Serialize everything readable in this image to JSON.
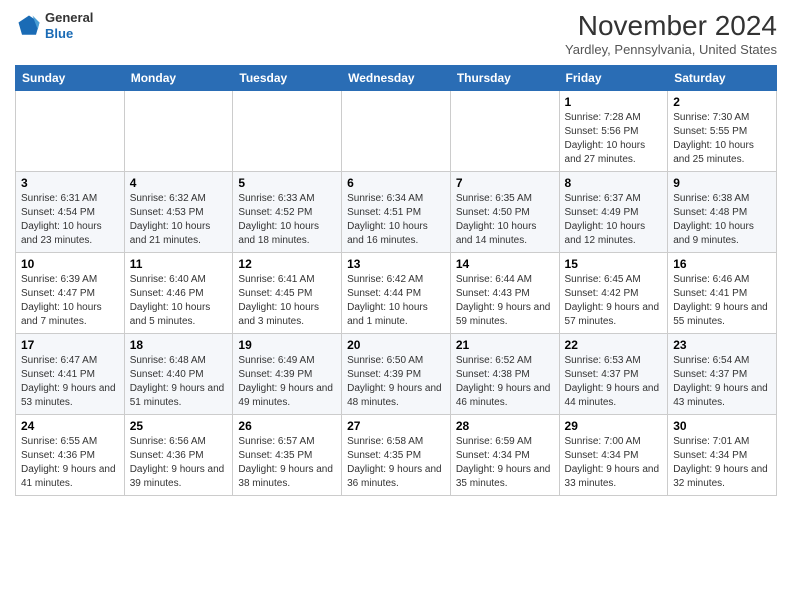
{
  "header": {
    "logo": {
      "line1": "General",
      "line2": "Blue"
    },
    "title": "November 2024",
    "location": "Yardley, Pennsylvania, United States"
  },
  "days_of_week": [
    "Sunday",
    "Monday",
    "Tuesday",
    "Wednesday",
    "Thursday",
    "Friday",
    "Saturday"
  ],
  "weeks": [
    [
      {
        "day": "",
        "info": ""
      },
      {
        "day": "",
        "info": ""
      },
      {
        "day": "",
        "info": ""
      },
      {
        "day": "",
        "info": ""
      },
      {
        "day": "",
        "info": ""
      },
      {
        "day": "1",
        "info": "Sunrise: 7:28 AM\nSunset: 5:56 PM\nDaylight: 10 hours and 27 minutes."
      },
      {
        "day": "2",
        "info": "Sunrise: 7:30 AM\nSunset: 5:55 PM\nDaylight: 10 hours and 25 minutes."
      }
    ],
    [
      {
        "day": "3",
        "info": "Sunrise: 6:31 AM\nSunset: 4:54 PM\nDaylight: 10 hours and 23 minutes."
      },
      {
        "day": "4",
        "info": "Sunrise: 6:32 AM\nSunset: 4:53 PM\nDaylight: 10 hours and 21 minutes."
      },
      {
        "day": "5",
        "info": "Sunrise: 6:33 AM\nSunset: 4:52 PM\nDaylight: 10 hours and 18 minutes."
      },
      {
        "day": "6",
        "info": "Sunrise: 6:34 AM\nSunset: 4:51 PM\nDaylight: 10 hours and 16 minutes."
      },
      {
        "day": "7",
        "info": "Sunrise: 6:35 AM\nSunset: 4:50 PM\nDaylight: 10 hours and 14 minutes."
      },
      {
        "day": "8",
        "info": "Sunrise: 6:37 AM\nSunset: 4:49 PM\nDaylight: 10 hours and 12 minutes."
      },
      {
        "day": "9",
        "info": "Sunrise: 6:38 AM\nSunset: 4:48 PM\nDaylight: 10 hours and 9 minutes."
      }
    ],
    [
      {
        "day": "10",
        "info": "Sunrise: 6:39 AM\nSunset: 4:47 PM\nDaylight: 10 hours and 7 minutes."
      },
      {
        "day": "11",
        "info": "Sunrise: 6:40 AM\nSunset: 4:46 PM\nDaylight: 10 hours and 5 minutes."
      },
      {
        "day": "12",
        "info": "Sunrise: 6:41 AM\nSunset: 4:45 PM\nDaylight: 10 hours and 3 minutes."
      },
      {
        "day": "13",
        "info": "Sunrise: 6:42 AM\nSunset: 4:44 PM\nDaylight: 10 hours and 1 minute."
      },
      {
        "day": "14",
        "info": "Sunrise: 6:44 AM\nSunset: 4:43 PM\nDaylight: 9 hours and 59 minutes."
      },
      {
        "day": "15",
        "info": "Sunrise: 6:45 AM\nSunset: 4:42 PM\nDaylight: 9 hours and 57 minutes."
      },
      {
        "day": "16",
        "info": "Sunrise: 6:46 AM\nSunset: 4:41 PM\nDaylight: 9 hours and 55 minutes."
      }
    ],
    [
      {
        "day": "17",
        "info": "Sunrise: 6:47 AM\nSunset: 4:41 PM\nDaylight: 9 hours and 53 minutes."
      },
      {
        "day": "18",
        "info": "Sunrise: 6:48 AM\nSunset: 4:40 PM\nDaylight: 9 hours and 51 minutes."
      },
      {
        "day": "19",
        "info": "Sunrise: 6:49 AM\nSunset: 4:39 PM\nDaylight: 9 hours and 49 minutes."
      },
      {
        "day": "20",
        "info": "Sunrise: 6:50 AM\nSunset: 4:39 PM\nDaylight: 9 hours and 48 minutes."
      },
      {
        "day": "21",
        "info": "Sunrise: 6:52 AM\nSunset: 4:38 PM\nDaylight: 9 hours and 46 minutes."
      },
      {
        "day": "22",
        "info": "Sunrise: 6:53 AM\nSunset: 4:37 PM\nDaylight: 9 hours and 44 minutes."
      },
      {
        "day": "23",
        "info": "Sunrise: 6:54 AM\nSunset: 4:37 PM\nDaylight: 9 hours and 43 minutes."
      }
    ],
    [
      {
        "day": "24",
        "info": "Sunrise: 6:55 AM\nSunset: 4:36 PM\nDaylight: 9 hours and 41 minutes."
      },
      {
        "day": "25",
        "info": "Sunrise: 6:56 AM\nSunset: 4:36 PM\nDaylight: 9 hours and 39 minutes."
      },
      {
        "day": "26",
        "info": "Sunrise: 6:57 AM\nSunset: 4:35 PM\nDaylight: 9 hours and 38 minutes."
      },
      {
        "day": "27",
        "info": "Sunrise: 6:58 AM\nSunset: 4:35 PM\nDaylight: 9 hours and 36 minutes."
      },
      {
        "day": "28",
        "info": "Sunrise: 6:59 AM\nSunset: 4:34 PM\nDaylight: 9 hours and 35 minutes."
      },
      {
        "day": "29",
        "info": "Sunrise: 7:00 AM\nSunset: 4:34 PM\nDaylight: 9 hours and 33 minutes."
      },
      {
        "day": "30",
        "info": "Sunrise: 7:01 AM\nSunset: 4:34 PM\nDaylight: 9 hours and 32 minutes."
      }
    ]
  ]
}
